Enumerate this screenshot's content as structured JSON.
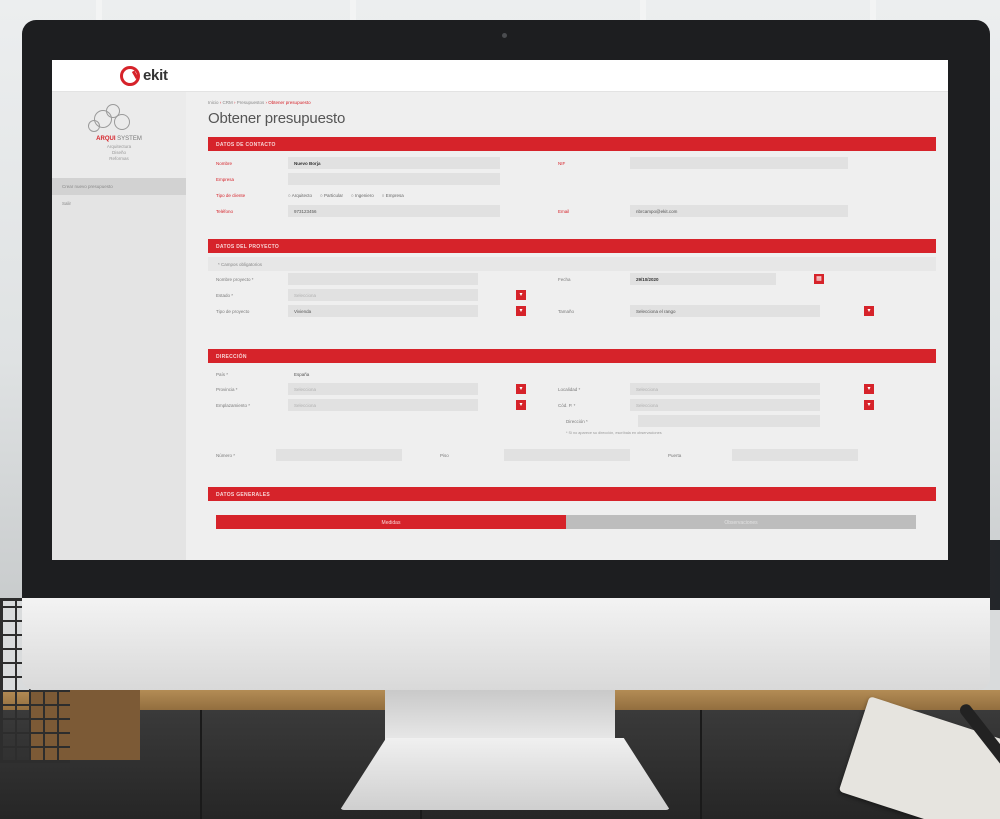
{
  "app": {
    "logo_text": "ekit"
  },
  "sidebar": {
    "brand_name_a": "ARQUI",
    "brand_name_b": "SYSTEM",
    "brand_lines": [
      "Arquitectura",
      "Diseño",
      "Reformas"
    ],
    "items": [
      {
        "label": "Crear nuevo presupuesto",
        "active": true
      },
      {
        "label": "Salir",
        "active": false
      }
    ]
  },
  "breadcrumb": {
    "parts": [
      "Inicio",
      "CRM",
      "Presupuestos"
    ],
    "current": "Obtener presupuesto"
  },
  "page_title": "Obtener presupuesto",
  "sections": {
    "contact": {
      "title": "DATOS DE CONTACTO",
      "nombre_label": "Nombre",
      "nombre_value": "Nuevo Borja",
      "nif_label": "NIF",
      "empresa_label": "Empresa",
      "tipo_label": "Tipo de cliente",
      "tipo_options": [
        "Arquitecto",
        "Particular",
        "Ingeniero",
        "Empresa"
      ],
      "telefono_label": "Teléfono",
      "telefono_value": "973123456",
      "email_label": "Email",
      "email_value": "nbrcampo@ekit.com"
    },
    "project": {
      "title": "DATOS DEL PROYECTO",
      "note": "* Campos obligatorios",
      "nombre_label": "Nombre proyecto *",
      "fecha_label": "Fecha",
      "fecha_value": "29/10/2020",
      "estado_label": "Estado *",
      "estado_value": "Selecciona",
      "tipo_label": "Tipo de proyecto",
      "tipo_value": "Vivienda",
      "tamano_label": "Tamaño",
      "tamano_value": "Selecciona el rango"
    },
    "address": {
      "title": "DIRECCIÓN",
      "pais_label": "País *",
      "pais_value": "España",
      "provincia_label": "Provincia *",
      "provincia_value": "Selecciona",
      "localidad_label": "Localidad *",
      "localidad_value": "Selecciona",
      "emplazamiento_label": "Emplazamiento *",
      "emplazamiento_value": "Selecciona",
      "cp_label": "Cód. P. *",
      "cp_value": "Selecciona",
      "direccion_label": "Dirección *",
      "direccion_hint": "* Si no aparece su dirección, escríbala en observaciones",
      "numero_label": "Número *",
      "piso_label": "Piso",
      "puerta_label": "Puerta"
    },
    "general": {
      "title": "DATOS GENERALES",
      "tabs": [
        {
          "label": "Medidas",
          "active": true
        },
        {
          "label": "Observaciones",
          "active": false
        }
      ]
    }
  },
  "colors": {
    "accent": "#d6232a",
    "screen_bg": "#efefef",
    "field_bg": "#e1e1e1"
  },
  "icons": {
    "calendar": "calendar-icon",
    "dropdown": "chevron-down-icon"
  }
}
